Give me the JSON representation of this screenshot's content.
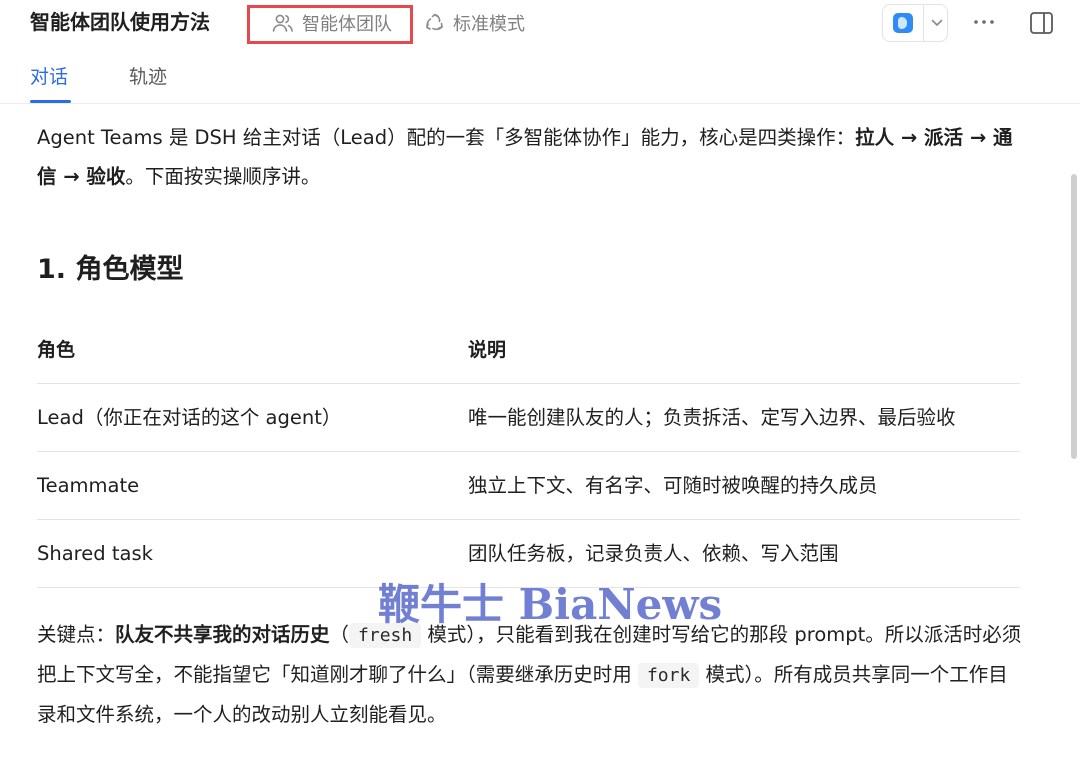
{
  "header": {
    "title": "智能体团队使用方法",
    "agent_mode_label": "智能体团队",
    "standard_mode_label": "标准模式",
    "more_label": "⋯"
  },
  "tabs": [
    {
      "label": "对话",
      "active": true
    },
    {
      "label": "轨迹",
      "active": false
    }
  ],
  "intro": {
    "part1": "Agent Teams 是 DSH 给主对话（Lead）配的一套「多智能体协作」能力，核心是四类操作：",
    "bold": "拉人 → 派活 → 通信 → 验收",
    "part2": "。下面按实操顺序讲。"
  },
  "section_heading": "1. 角色模型",
  "table": {
    "headers": [
      "角色",
      "说明"
    ],
    "rows": [
      [
        "Lead（你正在对话的这个 agent）",
        "唯一能创建队友的人；负责拆活、定写入边界、最后验收"
      ],
      [
        "Teammate",
        "独立上下文、有名字、可随时被唤醒的持久成员"
      ],
      [
        "Shared task",
        "团队任务板，记录负责人、依赖、写入范围"
      ]
    ]
  },
  "note": {
    "prefix": "关键点：",
    "bold": "队友不共享我的对话历史",
    "t1": "（",
    "code1": "fresh",
    "t2": " 模式），只能看到我在创建时写给它的那段 prompt。所以派活时必须把上下文写全，不能指望它「知道刚才聊了什么」（需要继承历史时用 ",
    "code2": "fork",
    "t3": " 模式）。所有成员共享同一个工作目录和文件系统，一个人的改动别人立刻能看见。"
  },
  "watermark": "鞭牛士 BiaNews",
  "colors": {
    "accent": "#2e6ce6",
    "highlight_box": "#e5484d",
    "watermark": "#4a5cc8"
  }
}
